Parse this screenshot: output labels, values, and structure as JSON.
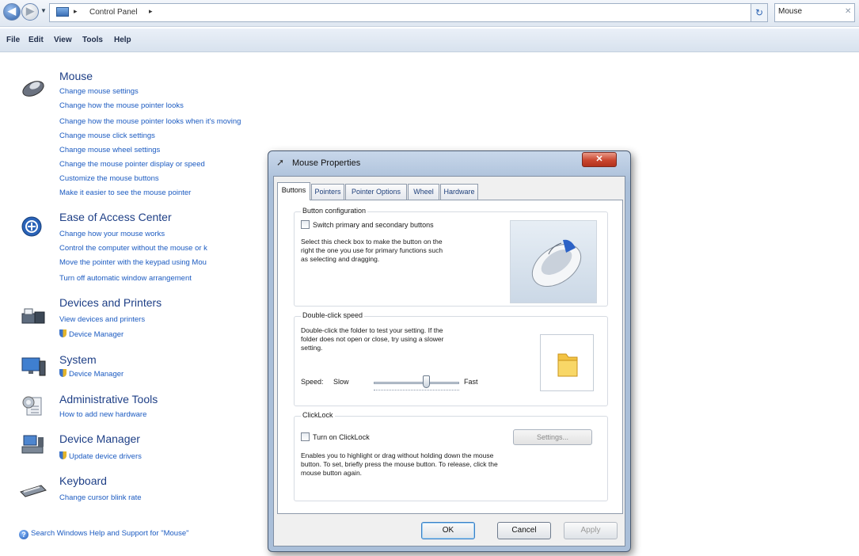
{
  "address_bar": {
    "path": "Control Panel",
    "search_value": "Mouse"
  },
  "menu": [
    "File",
    "Edit",
    "View",
    "Tools",
    "Help"
  ],
  "results": {
    "mouse": {
      "title": "Mouse",
      "links": [
        "Change mouse settings",
        "Change how the mouse pointer looks",
        "Change how the mouse pointer looks when it's moving",
        "Change mouse click settings",
        "Change mouse wheel settings",
        "Change the mouse pointer display or speed",
        "Customize the mouse buttons",
        "Make it easier to see the mouse pointer"
      ]
    },
    "ease": {
      "title": "Ease of Access Center",
      "links": [
        "Change how your mouse works",
        "Control the computer without the mouse or k",
        "Move the pointer with the keypad using Mou",
        "Turn off automatic window arrangement"
      ]
    },
    "devices": {
      "title": "Devices and Printers",
      "links": [
        "View devices and printers",
        "Device Manager"
      ]
    },
    "system": {
      "title": "System",
      "links": [
        "Device Manager"
      ]
    },
    "admin": {
      "title": "Administrative Tools",
      "links": [
        "How to add new hardware"
      ]
    },
    "devmgr": {
      "title": "Device Manager",
      "links": [
        "Update device drivers"
      ]
    },
    "keyboard": {
      "title": "Keyboard",
      "links": [
        "Change cursor blink rate"
      ]
    }
  },
  "status": "Search Windows Help and Support for \"Mouse\"",
  "dialog": {
    "title": "Mouse Properties",
    "tabs": [
      "Buttons",
      "Pointers",
      "Pointer Options",
      "Wheel",
      "Hardware"
    ],
    "button_config": {
      "title": "Button configuration",
      "checkbox": "Switch primary and secondary buttons",
      "desc_lines": [
        "Select this check box to make the button on the",
        "right the one you use for primary functions such",
        "as selecting and dragging."
      ]
    },
    "double_click": {
      "title": "Double-click speed",
      "desc_lines": [
        "Double-click the folder to test your setting.  If the",
        "folder does not open or close, try using a slower",
        "setting."
      ],
      "speed_label": "Speed:",
      "slow": "Slow",
      "fast": "Fast",
      "speed_level": 0.62
    },
    "clicklock": {
      "title": "ClickLock",
      "checkbox": "Turn on ClickLock",
      "settings": "Settings...",
      "desc_lines": [
        "Enables you to highlight or drag without holding down the mouse",
        "button. To set, briefly press the mouse button. To release, click the",
        "mouse button again."
      ]
    },
    "buttons": {
      "ok": "OK",
      "cancel": "Cancel",
      "apply": "Apply"
    }
  },
  "colors": {
    "link": "#1c5bc1",
    "heading": "#1e3f86",
    "close": "#c9462f"
  }
}
